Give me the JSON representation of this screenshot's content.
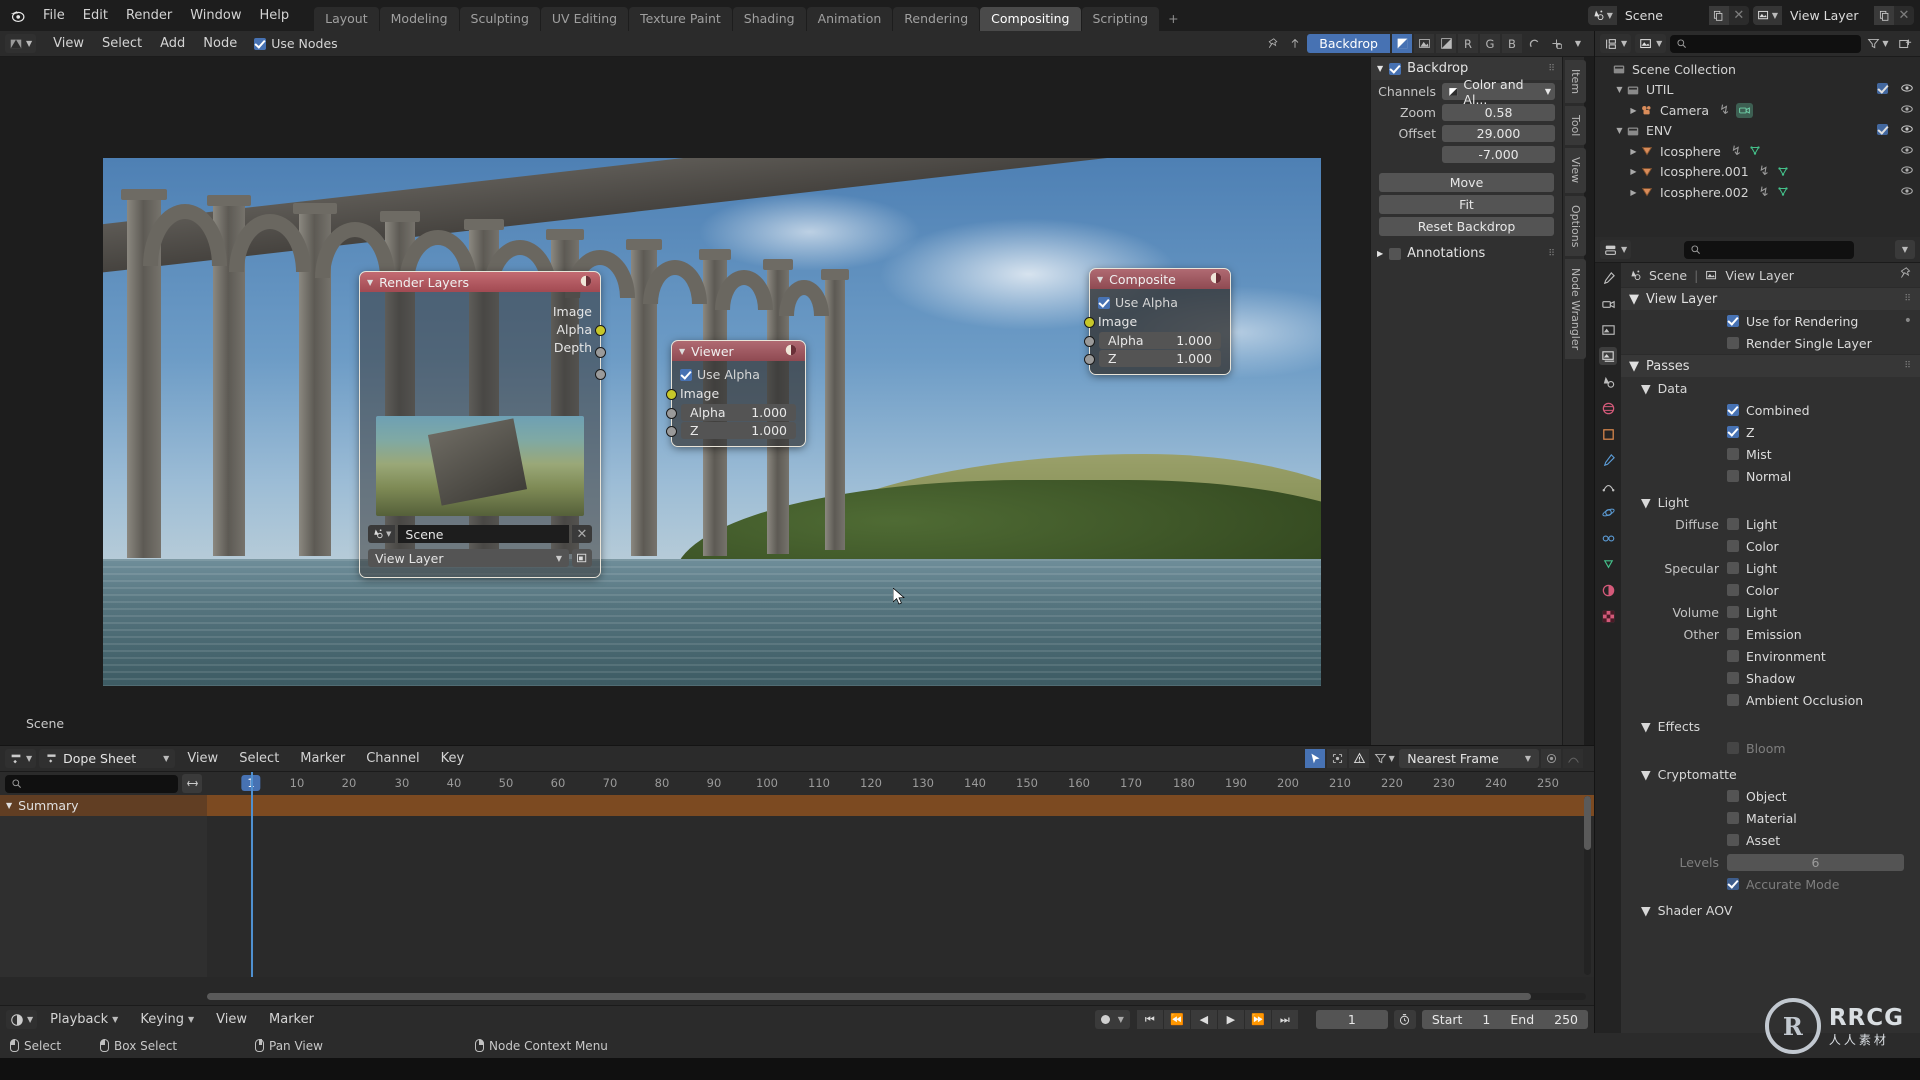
{
  "topbar": {
    "menus": [
      "File",
      "Edit",
      "Render",
      "Window",
      "Help"
    ],
    "workspaces": [
      "Layout",
      "Modeling",
      "Sculpting",
      "UV Editing",
      "Texture Paint",
      "Shading",
      "Animation",
      "Rendering",
      "Compositing",
      "Scripting"
    ],
    "active_workspace": "Compositing",
    "add_workspace": "+",
    "scene_name": "Scene",
    "view_layer_name": "View Layer"
  },
  "node_editor": {
    "header_menus": [
      "View",
      "Select",
      "Add",
      "Node"
    ],
    "use_nodes_label": "Use Nodes",
    "use_nodes_checked": true,
    "backdrop_button": "Backdrop",
    "channel_buttons": [
      "R",
      "G",
      "B"
    ],
    "scene_overlay_label": "Scene",
    "nodes": {
      "render_layers": {
        "title": "Render Layers",
        "outputs": [
          "Image",
          "Alpha",
          "Depth"
        ],
        "scene_field": "Scene",
        "layer_field": "View Layer"
      },
      "viewer": {
        "title": "Viewer",
        "use_alpha_label": "Use Alpha",
        "use_alpha_checked": true,
        "input_image": "Image",
        "alpha_label": "Alpha",
        "alpha_value": "1.000",
        "z_label": "Z",
        "z_value": "1.000"
      },
      "composite": {
        "title": "Composite",
        "use_alpha_label": "Use Alpha",
        "use_alpha_checked": true,
        "input_image": "Image",
        "alpha_label": "Alpha",
        "alpha_value": "1.000",
        "z_label": "Z",
        "z_value": "1.000"
      }
    }
  },
  "n_panel": {
    "tabs": [
      "Item",
      "Tool",
      "View",
      "Options",
      "Node Wrangler"
    ],
    "backdrop": {
      "title": "Backdrop",
      "enabled": true,
      "channels_label": "Channels",
      "channels_value": "Color and Al...",
      "zoom_label": "Zoom",
      "zoom_value": "0.58",
      "offset_label": "Offset",
      "offset_x": "29.000",
      "offset_y": "-7.000",
      "move_button": "Move",
      "fit_button": "Fit",
      "reset_button": "Reset Backdrop"
    },
    "annotations": {
      "title": "Annotations",
      "enabled": false
    }
  },
  "outliner": {
    "search_placeholder": "",
    "rows": [
      {
        "label": "Scene Collection",
        "depth": 0,
        "icon": "collection-icon",
        "tri": "",
        "checkbox": null,
        "eye": false
      },
      {
        "label": "UTIL",
        "depth": 1,
        "icon": "collection-icon",
        "tri": "down",
        "checkbox": true,
        "eye": true
      },
      {
        "label": "Camera",
        "depth": 2,
        "icon": "camera-object-icon",
        "tri": "right",
        "checkbox": null,
        "eye": true
      },
      {
        "label": "ENV",
        "depth": 1,
        "icon": "collection-icon",
        "tri": "down",
        "checkbox": true,
        "eye": true
      },
      {
        "label": "Icosphere",
        "depth": 2,
        "icon": "mesh-object-icon",
        "tri": "right",
        "checkbox": null,
        "eye": true
      },
      {
        "label": "Icosphere.001",
        "depth": 2,
        "icon": "mesh-object-icon",
        "tri": "right",
        "checkbox": null,
        "eye": true
      },
      {
        "label": "Icosphere.002",
        "depth": 2,
        "icon": "mesh-object-icon",
        "tri": "right",
        "checkbox": null,
        "eye": true
      }
    ]
  },
  "properties": {
    "search_placeholder": "",
    "breadcrumb": {
      "scene": "Scene",
      "view_layer": "View Layer"
    },
    "view_layer_section": {
      "title": "View Layer",
      "use_for_rendering": {
        "label": "Use for Rendering",
        "checked": true
      },
      "render_single_layer": {
        "label": "Render Single Layer",
        "checked": false
      }
    },
    "passes_section": {
      "title": "Passes",
      "data": {
        "title": "Data",
        "items": [
          {
            "label": "Combined",
            "checked": true
          },
          {
            "label": "Z",
            "checked": true
          },
          {
            "label": "Mist",
            "checked": false
          },
          {
            "label": "Normal",
            "checked": false
          }
        ]
      },
      "light": {
        "title": "Light",
        "groups": [
          {
            "label": "Diffuse",
            "items": [
              {
                "label": "Light",
                "checked": false
              },
              {
                "label": "Color",
                "checked": false
              }
            ]
          },
          {
            "label": "Specular",
            "items": [
              {
                "label": "Light",
                "checked": false
              },
              {
                "label": "Color",
                "checked": false
              }
            ]
          },
          {
            "label": "Volume",
            "items": [
              {
                "label": "Light",
                "checked": false
              }
            ]
          },
          {
            "label": "Other",
            "items": [
              {
                "label": "Emission",
                "checked": false
              },
              {
                "label": "Environment",
                "checked": false
              },
              {
                "label": "Shadow",
                "checked": false
              },
              {
                "label": "Ambient Occlusion",
                "checked": false
              }
            ]
          }
        ]
      },
      "effects": {
        "title": "Effects",
        "items": [
          {
            "label": "Bloom",
            "checked": false,
            "disabled": true
          }
        ]
      },
      "cryptomatte": {
        "title": "Cryptomatte",
        "items": [
          {
            "label": "Object",
            "checked": false
          },
          {
            "label": "Material",
            "checked": false
          },
          {
            "label": "Asset",
            "checked": false
          }
        ],
        "levels_label": "Levels",
        "levels_value": "6",
        "accurate_mode": {
          "label": "Accurate Mode",
          "checked": true,
          "disabled": true
        }
      },
      "shader_aov": {
        "title": "Shader AOV"
      }
    }
  },
  "dope_sheet": {
    "editor_name": "Dope Sheet",
    "menus": [
      "View",
      "Select",
      "Marker",
      "Channel",
      "Key"
    ],
    "search_placeholder": "",
    "snap_value": "Nearest Frame",
    "summary_label": "Summary",
    "ticks": [
      10,
      20,
      30,
      40,
      50,
      60,
      70,
      80,
      90,
      100,
      110,
      120,
      130,
      140,
      150,
      160,
      170,
      180,
      190,
      200,
      210,
      220,
      230,
      240,
      250
    ],
    "current_frame_badge": "1"
  },
  "timeline_footer": {
    "menus": [
      "Playback",
      "Keying",
      "View",
      "Marker"
    ],
    "current_frame": "1",
    "start_label": "Start",
    "start_value": "1",
    "end_label": "End",
    "end_value": "250"
  },
  "statusbar": {
    "items": [
      {
        "mouse": "lmb",
        "label": "Select"
      },
      {
        "mouse": "lmb-drag",
        "label": "Box Select"
      },
      {
        "mouse": "mmb",
        "label": "Pan View"
      },
      {
        "mouse": "rmb",
        "label": "Node Context Menu"
      }
    ]
  },
  "watermark": {
    "logo": "R",
    "title": "RRCG",
    "subtitle": "人人素材"
  },
  "colors": {
    "accent_blue": "#4772b3",
    "node_header_red": "#a24747",
    "socket_yellow": "#c7c729",
    "socket_grey": "#9a9a9a",
    "summary_orange": "#7c4a21"
  }
}
